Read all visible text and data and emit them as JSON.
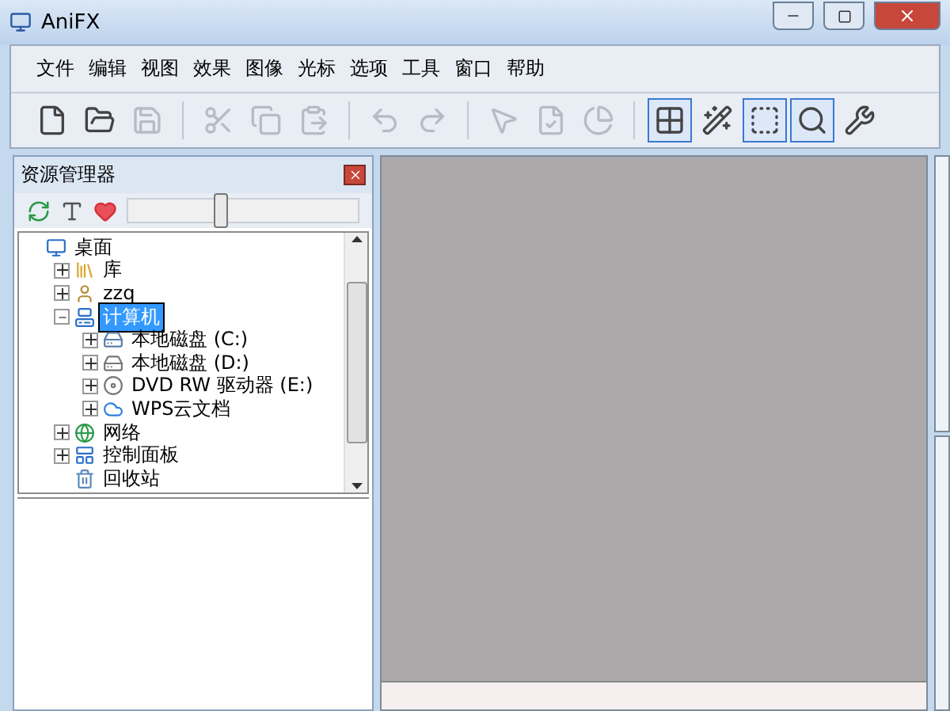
{
  "window": {
    "title": "AniFX"
  },
  "menu": [
    "文件",
    "编辑",
    "视图",
    "效果",
    "图像",
    "光标",
    "选项",
    "工具",
    "窗口",
    "帮助"
  ],
  "toolbar": [
    {
      "kind": "new",
      "disabled": false,
      "pressed": false
    },
    {
      "kind": "open",
      "disabled": false,
      "pressed": false
    },
    {
      "kind": "save",
      "disabled": true,
      "pressed": false
    },
    {
      "kind": "sep"
    },
    {
      "kind": "cut",
      "disabled": true,
      "pressed": false
    },
    {
      "kind": "copy",
      "disabled": true,
      "pressed": false
    },
    {
      "kind": "paste",
      "disabled": true,
      "pressed": false
    },
    {
      "kind": "sep"
    },
    {
      "kind": "undo",
      "disabled": true,
      "pressed": false
    },
    {
      "kind": "redo",
      "disabled": true,
      "pressed": false
    },
    {
      "kind": "sep"
    },
    {
      "kind": "pointer",
      "disabled": true,
      "pressed": false
    },
    {
      "kind": "check",
      "disabled": true,
      "pressed": false
    },
    {
      "kind": "circle",
      "disabled": true,
      "pressed": false
    },
    {
      "kind": "sep"
    },
    {
      "kind": "grid",
      "disabled": false,
      "pressed": true
    },
    {
      "kind": "wand",
      "disabled": false,
      "pressed": false
    },
    {
      "kind": "select",
      "disabled": false,
      "pressed": true
    },
    {
      "kind": "zoom",
      "disabled": false,
      "pressed": true
    },
    {
      "kind": "tools",
      "disabled": false,
      "pressed": false
    }
  ],
  "explorer": {
    "title": "资源管理器",
    "slider": {
      "level": 0.4
    },
    "tree": [
      {
        "label": "桌面",
        "kind": "desktop",
        "selected": false,
        "children": [
          {
            "label": "库",
            "kind": "library",
            "expanded": false,
            "selected": false
          },
          {
            "label": "zzq",
            "kind": "user",
            "expanded": false,
            "selected": false
          },
          {
            "label": "计算机",
            "kind": "computer",
            "expanded": true,
            "selected": true,
            "children": [
              {
                "label": "本地磁盘 (C:)",
                "kind": "system-drive",
                "expanded": false,
                "selected": false
              },
              {
                "label": "本地磁盘 (D:)",
                "kind": "drive",
                "expanded": false,
                "selected": false
              },
              {
                "label": "DVD RW 驱动器 (E:)",
                "kind": "dvd",
                "expanded": false,
                "selected": false
              },
              {
                "label": "WPS云文档",
                "kind": "cloud",
                "expanded": false,
                "selected": false
              }
            ]
          },
          {
            "label": "网络",
            "kind": "network",
            "expanded": false,
            "selected": false
          },
          {
            "label": "控制面板",
            "kind": "panel",
            "expanded": false,
            "selected": false
          },
          {
            "label": "回收站",
            "kind": "trash",
            "selected": false
          }
        ]
      }
    ]
  }
}
